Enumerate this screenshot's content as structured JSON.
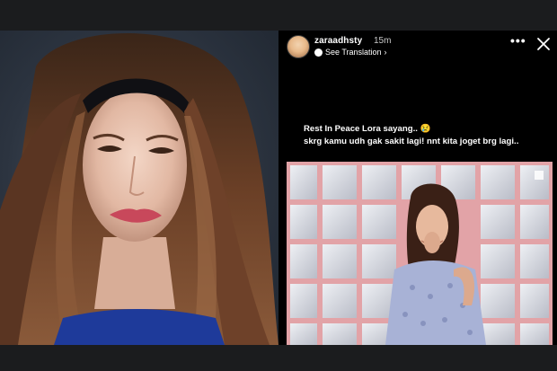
{
  "story": {
    "username": "zaraadhsty",
    "time": "15m",
    "translation_label": "See Translation",
    "caption_line1": "Rest In Peace Lora sayang.. 😢",
    "caption_line2": "skrg kamu udh gak sakit lagi! nnt kita joget brg lagi.."
  },
  "colors": {
    "background": "#1b1c1e",
    "story_background": "#000000",
    "text_primary": "#ffffff",
    "text_secondary": "#c9c9c9",
    "grid_frame": "#e2a3a7"
  },
  "icons": {
    "more": "more-horizontal-icon",
    "close": "close-icon",
    "translation": "globe-icon"
  }
}
